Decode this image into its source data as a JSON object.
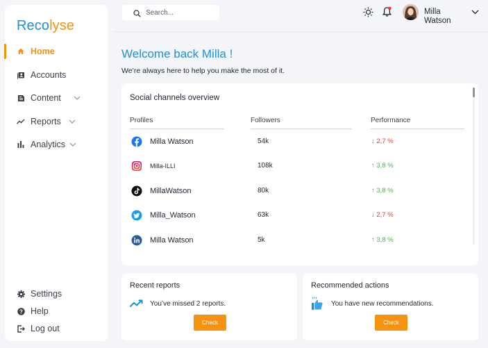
{
  "brand": {
    "part1": "Reco",
    "part2": "lyse"
  },
  "sidebar": {
    "items": [
      {
        "label": "Home",
        "icon": "home-icon"
      },
      {
        "label": "Accounts",
        "icon": "accounts-icon"
      },
      {
        "label": "Content",
        "icon": "content-icon"
      },
      {
        "label": "Reports",
        "icon": "trend-icon"
      },
      {
        "label": "Analytics",
        "icon": "bar-chart-icon"
      }
    ],
    "footer": [
      {
        "label": "Settings",
        "icon": "gear-icon"
      },
      {
        "label": "Help",
        "icon": "help-icon"
      },
      {
        "label": "Log out",
        "icon": "logout-icon"
      }
    ]
  },
  "topbar": {
    "search_placeholder": "Search...",
    "user_first": "Milla",
    "user_last": "Watson"
  },
  "welcome": {
    "title": "Welcome back Milla !",
    "subtitle": "We’re always here to help you make the most of it."
  },
  "overview": {
    "title": "Social channels overview",
    "columns": [
      "Profiles",
      "Followers",
      "Performance"
    ],
    "rows": [
      {
        "network": "facebook",
        "profile": "Milla Watson",
        "followers": "54k",
        "trend": "down",
        "performance": "2,7 %"
      },
      {
        "network": "instagram",
        "profile": "Milla-ILLI",
        "followers": "108k",
        "trend": "up",
        "performance": "3,8 %"
      },
      {
        "network": "tiktok",
        "profile": "MillaWatson",
        "followers": "80k",
        "trend": "up",
        "performance": "3,8 %"
      },
      {
        "network": "twitter",
        "profile": "Milla_Watson",
        "followers": "63k",
        "trend": "down",
        "performance": "2,7 %"
      },
      {
        "network": "linkedin",
        "profile": "Milla Watson",
        "followers": "5k",
        "trend": "up",
        "performance": "3,8 %"
      }
    ]
  },
  "recent_reports": {
    "title": "Recent reports",
    "message": "You’ve missed 2 reports.",
    "button": "Check"
  },
  "recommended": {
    "title": "Recommended actions",
    "message": "You have new recommendations.",
    "button": "Check"
  },
  "colors": {
    "brand_blue": "#1f8fd6",
    "brand_orange": "#f5920f",
    "down_red": "#e53935",
    "up_green": "#4caf50"
  }
}
